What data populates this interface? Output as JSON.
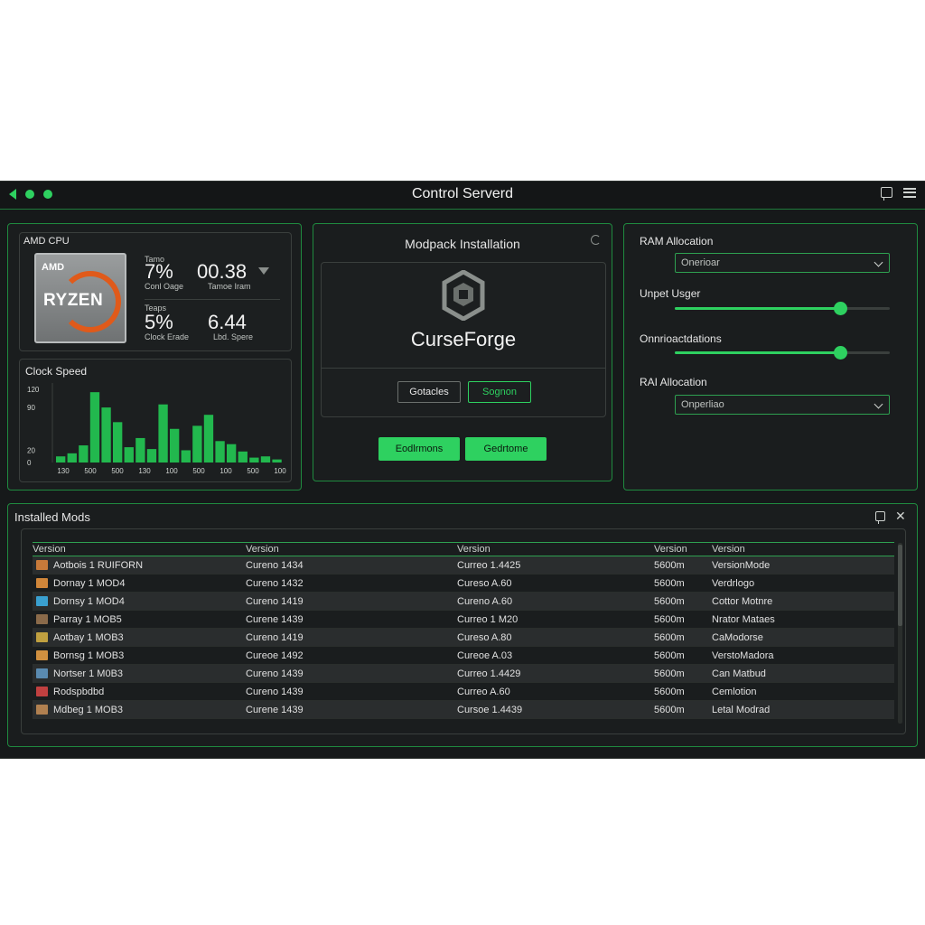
{
  "window": {
    "title": "Control Serverd"
  },
  "cpu": {
    "label": "AMD CPU",
    "chip_brand": "AMD",
    "chip_name": "RYZEN",
    "stats": [
      {
        "small": "Tamo",
        "value": "7%",
        "caption": "Conl Oage"
      },
      {
        "small": "",
        "value": "00.38",
        "caption": "Tamoe Iram"
      },
      {
        "small": "Teaps",
        "value": "5%",
        "caption": "Clock Erade"
      },
      {
        "small": "",
        "value": "6.44",
        "caption": "Lbd. Spere"
      }
    ]
  },
  "clock_speed": {
    "title": "Clock Speed",
    "y_ticks": [
      "120",
      "90",
      "20",
      "0"
    ],
    "x_ticks": [
      "130",
      "500",
      "500",
      "130",
      "100",
      "500",
      "100",
      "500",
      "100"
    ]
  },
  "chart_data": {
    "type": "bar",
    "title": "Clock Speed",
    "values": [
      10,
      15,
      28,
      115,
      90,
      66,
      25,
      40,
      22,
      95,
      55,
      20,
      60,
      78,
      35,
      30,
      18,
      8,
      10,
      5
    ],
    "ylim": [
      0,
      130
    ],
    "y_ticks": [
      "120",
      "90",
      "20",
      "0"
    ],
    "x_ticks": [
      "130",
      "500",
      "500",
      "130",
      "100",
      "500",
      "100",
      "500",
      "100"
    ]
  },
  "modpack": {
    "title": "Modpack Installation",
    "brand": "CurseForge",
    "btn_outline_1": "Gotacles",
    "btn_outline_2": "Sognon",
    "btn_green_1": "Eodlrmons",
    "btn_green_2": "Gedrtome"
  },
  "ram": {
    "title1": "RAM Allocation",
    "select1": "Onerioar",
    "slider1_label": "Unpet Usger",
    "slider1_value": 0.77,
    "slider2_label": "Onnrioactdations",
    "slider2_value": 0.77,
    "title2": "RAI Allocation",
    "select2": "Onperliao"
  },
  "mods": {
    "title": "Installed Mods",
    "columns": [
      "Version",
      "Version",
      "Version",
      "Version",
      "Version"
    ],
    "rows": [
      [
        "Aotbois 1 RUIFORN",
        "Cureno 1434",
        "Curreo 1.4425",
        "5600m",
        "VersionMode"
      ],
      [
        "Dornay 1 MOD4",
        "Cureno 1432",
        "Cureso A.60",
        "5600m",
        "Verdrlogo"
      ],
      [
        "Dornsy 1 MOD4",
        "Cureno 1419",
        "Cureno A.60",
        "5600m",
        "Cottor Motnre"
      ],
      [
        "Parray 1 MOB5",
        "Curene 1439",
        "Curreo 1 M20",
        "5600m",
        "Nrator Mataes"
      ],
      [
        "Aotbay 1 MOB3",
        "Cureno 1419",
        "Cureso A.80",
        "5600m",
        "CaModorse"
      ],
      [
        "Bornsg 1 MOB3",
        "Cureoe 1492",
        "Cureoe A.03",
        "5600m",
        "VerstoMadora"
      ],
      [
        "Nortser 1 M0B3",
        "Cureno 1439",
        "Curreo 1.4429",
        "5600m",
        "Can Matbud"
      ],
      [
        "Rodspbdbd",
        "Cureno 1439",
        "Curreo A.60",
        "5600m",
        "Cemlotion"
      ],
      [
        "Mdbeg 1 MOB3",
        "Curene 1439",
        "Cursoe 1.4439",
        "5600m",
        "Letal Modrad"
      ]
    ],
    "icon_colors": [
      "#c87a3a",
      "#d0863a",
      "#3aa0d0",
      "#8a6a4a",
      "#c0a040",
      "#d09040",
      "#5a8ab0",
      "#c04040",
      "#b08050"
    ]
  }
}
